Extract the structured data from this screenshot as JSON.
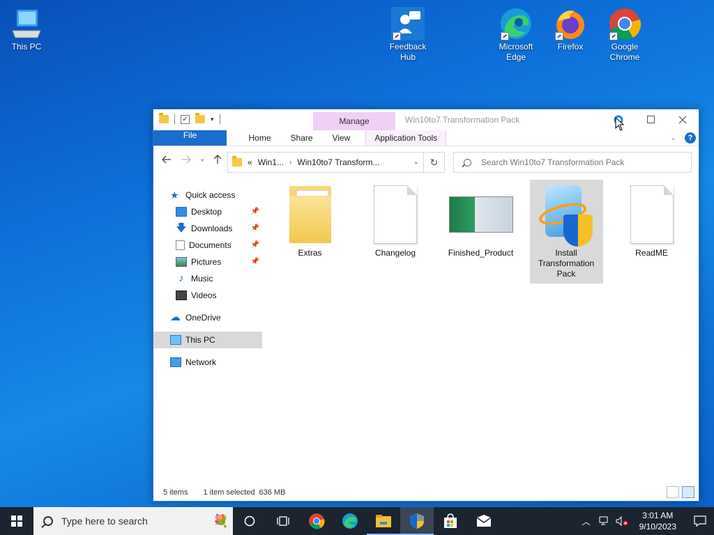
{
  "desktop": {
    "icons": [
      {
        "label": "This PC",
        "icon": "computer-icon"
      },
      {
        "label": "Feedback\nHub",
        "icon": "feedback-hub-icon"
      },
      {
        "label": "Microsoft\nEdge",
        "icon": "edge-icon"
      },
      {
        "label": "Firefox",
        "icon": "firefox-icon"
      },
      {
        "label": "Google\nChrome",
        "icon": "chrome-icon"
      }
    ]
  },
  "window": {
    "title": "Win10to7 Transformation Pack",
    "contextual_tab": "Manage",
    "ribbon_tabs": [
      "File",
      "Home",
      "Share",
      "View",
      "Application Tools"
    ],
    "address": {
      "overflow": "«",
      "crumbs": [
        "Win1...",
        "Win10to7 Transform..."
      ]
    },
    "search_placeholder": "Search Win10to7 Transformation Pack",
    "nav": {
      "quick_access": "Quick access",
      "pinned": [
        "Desktop",
        "Downloads",
        "Documents",
        "Pictures"
      ],
      "unpinned": [
        "Music",
        "Videos"
      ],
      "onedrive": "OneDrive",
      "this_pc": "This PC",
      "network": "Network"
    },
    "files": [
      {
        "name": "Extras",
        "type": "folder"
      },
      {
        "name": "Changelog",
        "type": "document"
      },
      {
        "name": "Finished_Product",
        "type": "image"
      },
      {
        "name": "Install Transformation Pack",
        "type": "installer",
        "selected": true
      },
      {
        "name": "ReadME",
        "type": "document"
      }
    ],
    "status": {
      "count": "5 items",
      "selection": "1 item selected",
      "size": "636 MB"
    }
  },
  "taskbar": {
    "search_placeholder": "Type here to search",
    "time": "3:01 AM",
    "date": "9/10/2023"
  },
  "colors": {
    "accent": "#1a6dcc",
    "taskbar": "#1c2430",
    "manage_tab": "#f0d0f5"
  }
}
